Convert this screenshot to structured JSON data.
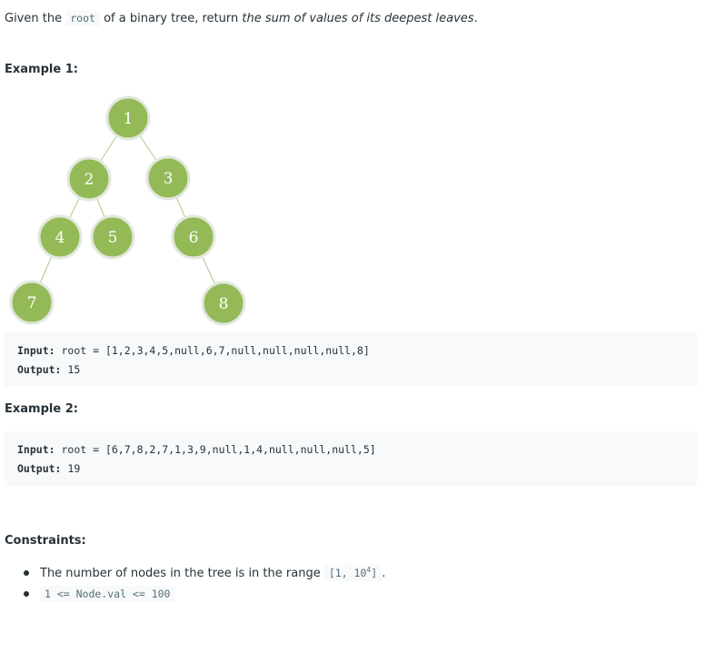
{
  "intro": {
    "prefix": "Given the",
    "code": "root",
    "middle": "of a binary tree, return",
    "emphasis": "the sum of values of its deepest leaves",
    "suffix": "."
  },
  "example1": {
    "heading": "Example 1:",
    "tree_nodes": [
      "1",
      "2",
      "3",
      "4",
      "5",
      "6",
      "7",
      "8"
    ],
    "input_label": "Input:",
    "input_value": "root = [1,2,3,4,5,null,6,7,null,null,null,null,8]",
    "output_label": "Output:",
    "output_value": "15"
  },
  "example2": {
    "heading": "Example 2:",
    "input_label": "Input:",
    "input_value": "root = [6,7,8,2,7,1,3,9,null,1,4,null,null,null,5]",
    "output_label": "Output:",
    "output_value": "19"
  },
  "constraints": {
    "heading": "Constraints:",
    "item1_text": "The number of nodes in the tree is in the range",
    "item1_code_prefix": "[1, 10",
    "item1_code_exp": "4",
    "item1_code_suffix": "]",
    "item1_end": ".",
    "item2_code": "1 <= Node.val <= 100"
  },
  "colors": {
    "node_fill": "#94ba58",
    "code_background": "#f7f9fa",
    "text": "#263238"
  }
}
